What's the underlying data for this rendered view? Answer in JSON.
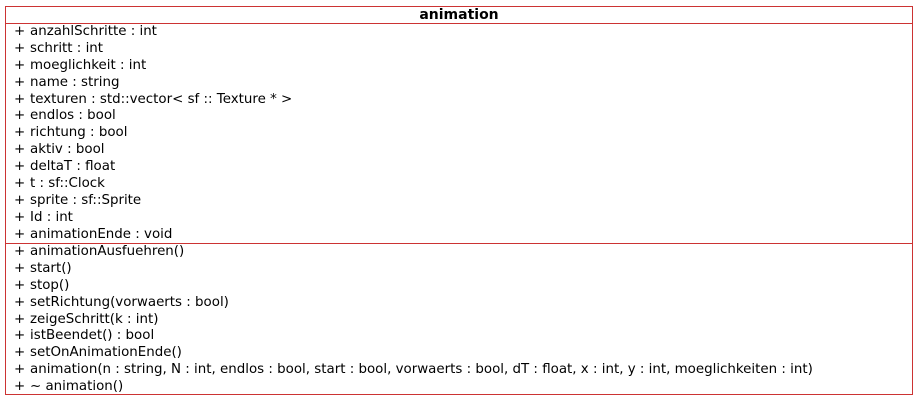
{
  "class_name": "animation",
  "attributes": [
    {
      "visibility": "+",
      "text": "anzahlSchritte : int"
    },
    {
      "visibility": "+",
      "text": "schritt : int"
    },
    {
      "visibility": "+",
      "text": "moeglichkeit : int"
    },
    {
      "visibility": "+",
      "text": "name : string"
    },
    {
      "visibility": "+",
      "text": "texturen : std::vector< sf :: Texture * >"
    },
    {
      "visibility": "+",
      "text": "endlos : bool"
    },
    {
      "visibility": "+",
      "text": "richtung : bool"
    },
    {
      "visibility": "+",
      "text": "aktiv : bool"
    },
    {
      "visibility": "+",
      "text": "deltaT : float"
    },
    {
      "visibility": "+",
      "text": "t : sf::Clock"
    },
    {
      "visibility": "+",
      "text": "sprite : sf::Sprite"
    },
    {
      "visibility": "+",
      "text": "Id : int"
    },
    {
      "visibility": "+",
      "text": "animationEnde : void"
    }
  ],
  "operations": [
    {
      "visibility": "+",
      "text": "animationAusfuehren()"
    },
    {
      "visibility": "+",
      "text": "start()"
    },
    {
      "visibility": "+",
      "text": "stop()"
    },
    {
      "visibility": "+",
      "text": "setRichtung(vorwaerts : bool)"
    },
    {
      "visibility": "+",
      "text": "zeigeSchritt(k : int)"
    },
    {
      "visibility": "+",
      "text": "istBeendet() : bool"
    },
    {
      "visibility": "+",
      "text": "setOnAnimationEnde()"
    },
    {
      "visibility": "+",
      "text": "animation(n : string, N : int, endlos : bool, start : bool, vorwaerts : bool, dT : float, x : int, y : int, moeglichkeiten : int)"
    },
    {
      "visibility": "+",
      "text": "~ animation()"
    }
  ],
  "colors": {
    "border": "#cc3333",
    "text": "#000000",
    "background": "#ffffff"
  }
}
